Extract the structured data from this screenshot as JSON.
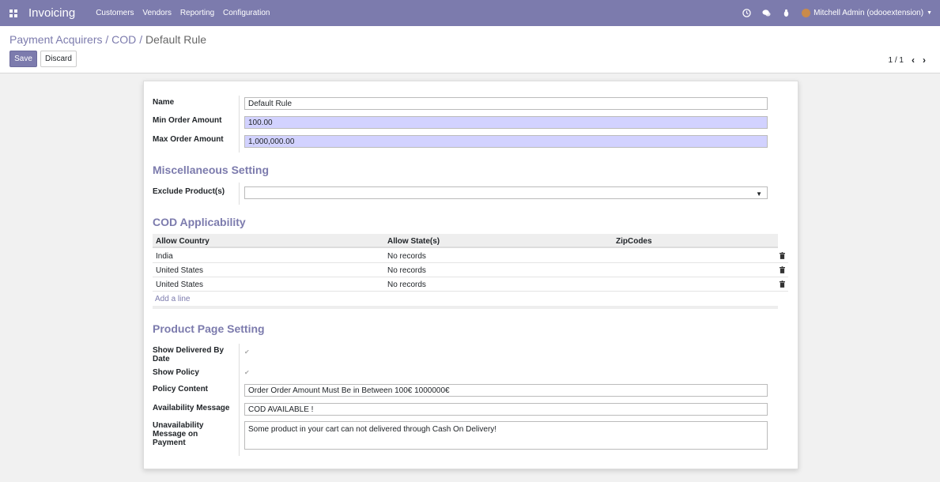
{
  "navbar": {
    "brand": "Invoicing",
    "menu": [
      "Customers",
      "Vendors",
      "Reporting",
      "Configuration"
    ],
    "user": "Mitchell Admin (odooextension)",
    "color": "#7c7bad"
  },
  "control": {
    "breadcrumb": [
      "Payment Acquirers",
      "COD",
      "Default Rule"
    ],
    "save_label": "Save",
    "discard_label": "Discard",
    "pager": "1 / 1"
  },
  "form": {
    "name_label": "Name",
    "name_value": "Default Rule",
    "min_label": "Min Order Amount",
    "min_value": "100.00",
    "max_label": "Max Order Amount",
    "max_value": "1,000,000.00",
    "misc_title": "Miscellaneous Setting",
    "exclude_label": "Exclude Product(s)",
    "exclude_value": "",
    "cod_title": "COD Applicability",
    "table": {
      "headers": [
        "Allow Country",
        "Allow State(s)",
        "ZipCodes"
      ],
      "rows": [
        {
          "country": "India",
          "states": "No records",
          "zip": ""
        },
        {
          "country": "United States",
          "states": "No records",
          "zip": ""
        },
        {
          "country": "United States",
          "states": "No records",
          "zip": ""
        }
      ],
      "add_line": "Add a line"
    },
    "product_title": "Product Page Setting",
    "delivered_label": "Show Delivered By Date",
    "policy_label": "Show Policy",
    "policy_content_label": "Policy Content",
    "policy_content_value": "Order Order Amount Must Be in Between 100€ 1000000€",
    "avail_label": "Availability Message",
    "avail_value": "COD AVAILABLE !",
    "unavail_label": "Unavailability Message on Payment",
    "unavail_value": "Some  product in your cart can not delivered  through Cash On Delivery!"
  }
}
